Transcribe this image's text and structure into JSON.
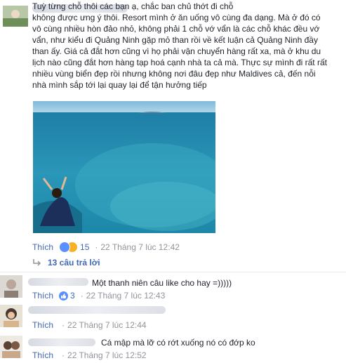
{
  "post": {
    "text": "Tuỳ từng chỗ thôi các bạn ạ, chắc ban chủ thớt đi chỗ\nkhông được ưng ý thôi. Resort mình ở ăn uống vô cùng đa dạng. Mà ở đó có\nvô cùng nhiều hòn đảo nhỏ, không phải 1 chỗ vớ vẩn là các chỗ khác đều vớ\nvẩn, như kiểu đi Quảng Ninh gặp mỏ than rồi về kết luận cả Quảng Ninh đầy\nthan ấy. Giá cả đắt hơn cũng vì họ phải vận chuyển hàng rất xa, mà ở khu du\nlịch nào cũng đắt hơn hàng tạp hoá cạnh nhà ta cả mà. Thực sự mình đi rất rất\nnhiều vùng biển đẹp rồi nhưng không nơi đâu đẹp như Maldives cả, đến nỗi\nnhà mình sắp tới lại quay lại để tận hưởng tiếp",
    "like_label": "Thích",
    "reaction_count": "15",
    "separator": "·",
    "timestamp": "22 Tháng 7 lúc 12:42",
    "replies_label": "13 câu trả lời"
  },
  "replies": [
    {
      "text": "Một thanh niên câu like cho hay =)))))",
      "like_label": "Thích",
      "like_count": "3",
      "separator": "·",
      "timestamp": "22 Tháng 7 lúc 12:43"
    },
    {
      "text": "",
      "like_label": "Thích",
      "separator": "·",
      "timestamp": "22 Tháng 7 lúc 12:44"
    },
    {
      "text": "Cá mập mà lỡ có rớt xuống nó có đớp ko",
      "like_label": "Thích",
      "separator": "·",
      "timestamp": "22 Tháng 7 lúc 12:52"
    }
  ],
  "colors": {
    "link_blue": "#4267b2",
    "meta_gray": "#90949c",
    "text": "#1d2129",
    "like_reaction": "#5890ff",
    "haha_reaction": "#f7b125"
  },
  "icons": [
    "like-reaction-icon",
    "haha-reaction-icon",
    "reply-arrow-icon"
  ]
}
